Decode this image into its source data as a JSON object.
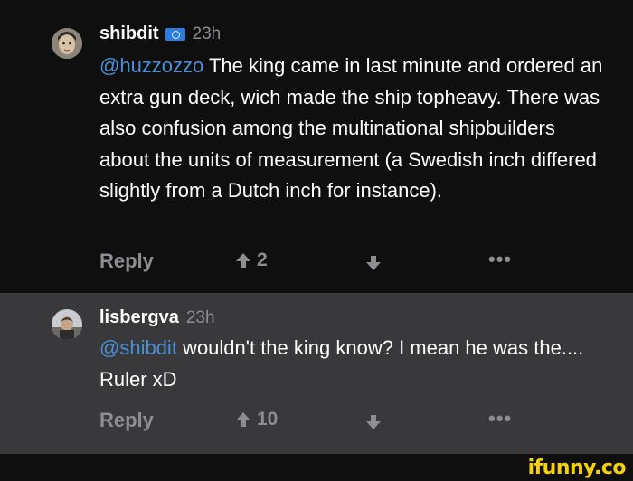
{
  "comments": [
    {
      "username": "shibdit",
      "time": "23h",
      "mention": "@huzzozzo",
      "text": " The king came in last minute and ordered an extra gun deck, wich made the ship topheavy. There was also confusion among the multinational shipbuilders about the units of measurement (a Swedish inch differed slightly from a Dutch inch for instance).",
      "reply_label": "Reply",
      "upvotes": "2",
      "more": "•••"
    },
    {
      "username": "lisbergva",
      "time": "23h",
      "mention": "@shibdit",
      "text": " wouldn't the king know? I mean he was the.... Ruler xD",
      "reply_label": "Reply",
      "upvotes": "10",
      "more": "•••"
    }
  ],
  "watermark": "ifunny.co",
  "colors": {
    "background": "#0f0f10",
    "highlight_background": "#39393b",
    "mention": "#4a8fd6",
    "muted": "#8e8e92",
    "watermark": "#f5d10a"
  }
}
